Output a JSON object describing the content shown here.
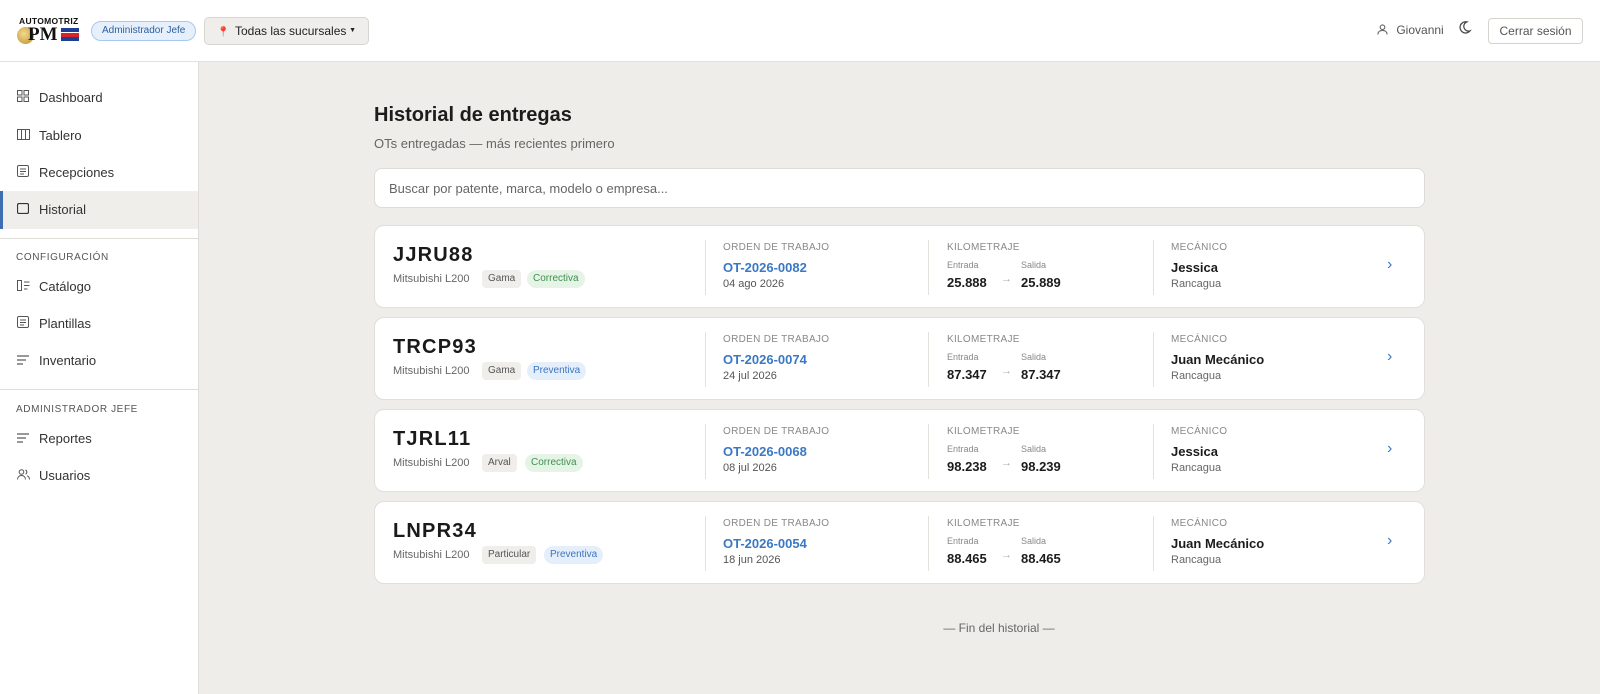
{
  "header": {
    "logo_top": "AUTOMOTRIZ",
    "logo_main": "PM",
    "role_badge": "Administrador Jefe",
    "branch_select": "Todas las sucursales",
    "user_name": "Giovanni",
    "logout_label": "Cerrar sesión"
  },
  "sidebar": {
    "items": [
      {
        "label": "Dashboard",
        "icon": "grid-icon"
      },
      {
        "label": "Tablero",
        "icon": "columns-icon"
      },
      {
        "label": "Recepciones",
        "icon": "list-box-icon"
      },
      {
        "label": "Historial",
        "icon": "square-icon",
        "active": true
      }
    ],
    "config_label": "CONFIGURACIÓN",
    "config_items": [
      {
        "label": "Catálogo",
        "icon": "catalog-icon"
      },
      {
        "label": "Plantillas",
        "icon": "list-box-icon"
      },
      {
        "label": "Inventario",
        "icon": "lines-icon"
      }
    ],
    "admin_label": "ADMINISTRADOR JEFE",
    "admin_items": [
      {
        "label": "Reportes",
        "icon": "lines-icon"
      },
      {
        "label": "Usuarios",
        "icon": "users-icon"
      }
    ]
  },
  "main": {
    "title": "Historial de entregas",
    "subtitle": "OTs entregadas — más recientes primero",
    "search_placeholder": "Buscar por patente, marca, modelo o empresa...",
    "col_ot": "ORDEN DE TRABAJO",
    "col_km": "KILOMETRAJE",
    "col_mech": "MECÁNICO",
    "km_in_label": "Entrada",
    "km_out_label": "Salida",
    "cards": [
      {
        "plate": "JJRU88",
        "model": "Mitsubishi L200",
        "client": "Gama",
        "type": "Correctiva",
        "ot": "OT-2026-0082",
        "date": "04 ago 2026",
        "km_in": "25.888",
        "km_out": "25.889",
        "mechanic": "Jessica",
        "branch": "Rancagua"
      },
      {
        "plate": "TRCP93",
        "model": "Mitsubishi L200",
        "client": "Gama",
        "type": "Preventiva",
        "ot": "OT-2026-0074",
        "date": "24 jul 2026",
        "km_in": "87.347",
        "km_out": "87.347",
        "mechanic": "Juan Mecánico",
        "branch": "Rancagua"
      },
      {
        "plate": "TJRL11",
        "model": "Mitsubishi L200",
        "client": "Arval",
        "type": "Correctiva",
        "ot": "OT-2026-0068",
        "date": "08 jul 2026",
        "km_in": "98.238",
        "km_out": "98.239",
        "mechanic": "Jessica",
        "branch": "Rancagua"
      },
      {
        "plate": "LNPR34",
        "model": "Mitsubishi L200",
        "client": "Particular",
        "type": "Preventiva",
        "ot": "OT-2026-0054",
        "date": "18 jun 2026",
        "km_in": "88.465",
        "km_out": "88.465",
        "mechanic": "Juan Mecánico",
        "branch": "Rancagua"
      }
    ],
    "end_note": "— Fin del historial —"
  },
  "colors": {
    "accent": "#3a78c5",
    "background": "#efedea",
    "correctiva_bg": "#e6f4e8",
    "preventiva_bg": "#e5effb"
  }
}
